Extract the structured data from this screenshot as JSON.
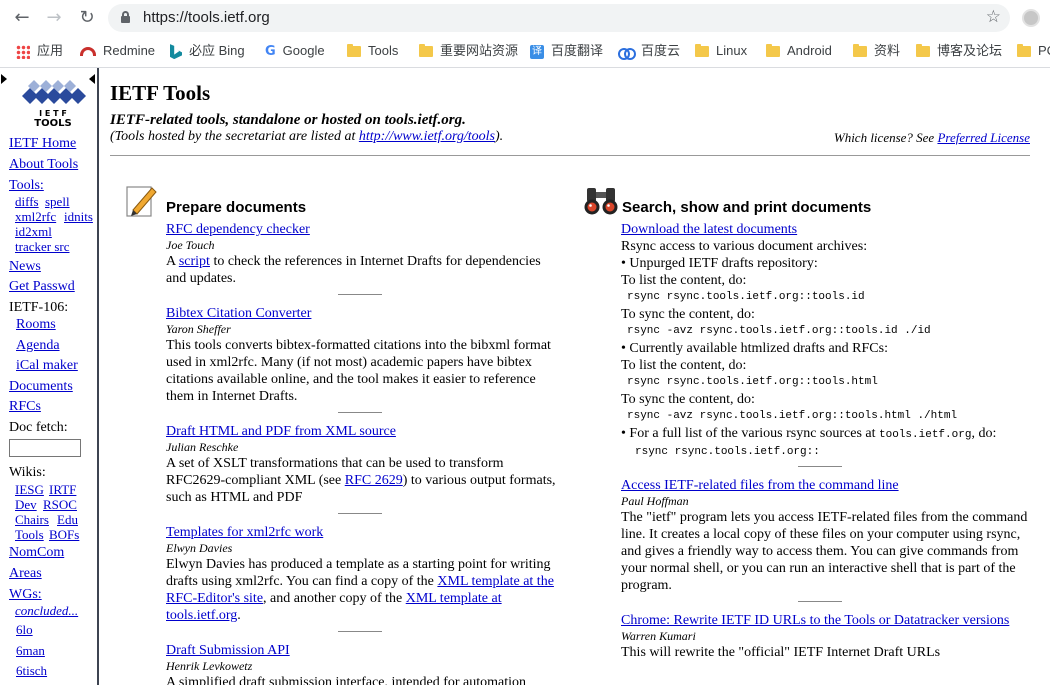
{
  "browser": {
    "url": "https://tools.ietf.org",
    "bookmarks": [
      {
        "label": "应用",
        "icon": "apps-grid-icon"
      },
      {
        "label": "Redmine",
        "icon": "redmine-icon"
      },
      {
        "label": "必应 Bing",
        "icon": "bing-icon"
      },
      {
        "label": "Google",
        "icon": "google-icon"
      },
      {
        "label": "Tools",
        "icon": "folder-icon"
      },
      {
        "label": "重要网站资源",
        "icon": "folder-icon"
      },
      {
        "label": "百度翻译",
        "icon": "translate-icon"
      },
      {
        "label": "百度云",
        "icon": "cloud-icon"
      },
      {
        "label": "Linux",
        "icon": "folder-icon"
      },
      {
        "label": "Android",
        "icon": "folder-icon"
      },
      {
        "label": "资料",
        "icon": "folder-icon"
      },
      {
        "label": "博客及论坛",
        "icon": "folder-icon"
      },
      {
        "label": "PC",
        "icon": "folder-icon"
      }
    ]
  },
  "sidebar": {
    "logo_text": "IETF TOOLS",
    "ietf_home": "IETF Home",
    "about_tools": "About Tools",
    "tools_label": "Tools:",
    "diffs": "diffs",
    "spell": "spell",
    "xml2rfc": "xml2rfc",
    "idnits": "idnits",
    "id2xml": "id2xml",
    "tracker_src": "tracker src",
    "news": "News",
    "get_passwd": "Get Passwd",
    "meeting": "IETF-106:",
    "rooms": "Rooms",
    "agenda": "Agenda",
    "ical": "iCal maker",
    "documents": "Documents",
    "rfcs": "RFCs",
    "doc_fetch": "Doc fetch:",
    "wikis": "Wikis:",
    "iesg": "IESG",
    "irtf": "IRTF",
    "dev": "Dev",
    "rsoc": "RSOC",
    "chairs": "Chairs",
    "edu": "Edu",
    "tools": "Tools",
    "bofs": "BOFs",
    "nomcom": "NomCom",
    "areas": "Areas",
    "wgs": "WGs:",
    "concluded": "concluded...",
    "wg1": "6lo",
    "wg2": "6man",
    "wg3": "6tisch"
  },
  "main": {
    "title": "IETF Tools",
    "subtitle": "IETF-related tools, standalone or hosted on tools.ietf.org.",
    "hosted_prefix": "(Tools hosted by the secretariat are listed at ",
    "hosted_link": "http://www.ietf.org/tools",
    "hosted_suffix": ").",
    "license_prefix": "Which license? See ",
    "license_link": "Preferred License"
  },
  "prepare": {
    "heading": "Prepare documents",
    "e1_title": "RFC dependency checker",
    "e1_author": "Joe Touch",
    "e1_a": "A ",
    "e1_link": "script",
    "e1_b": " to check the references in Internet Drafts for dependencies and updates.",
    "e2_title": "Bibtex Citation Converter",
    "e2_author": "Yaron Sheffer",
    "e2_desc": "This tools converts bibtex-formatted citations into the bibxml format used in xml2rfc. Many (if not most) academic papers have bibtex citations available online, and the tool makes it easier to reference them in Internet Drafts.",
    "e3_title": "Draft HTML and PDF from XML source",
    "e3_author": "Julian Reschke",
    "e3_a": "A set of XSLT transformations that can be used to transform RFC2629-compliant XML (see ",
    "e3_link": "RFC 2629",
    "e3_b": ") to various output formats, such as HTML and PDF",
    "e4_title": "Templates for xml2rfc work",
    "e4_author": "Elwyn Davies",
    "e4_a": "Elwyn Davies has produced a template as a starting point for writing drafts using xml2rfc. You can find a copy of the ",
    "e4_link1": "XML template at the RFC-Editor's site",
    "e4_b": ", and another copy of the ",
    "e4_link2": "XML template at tools.ietf.org",
    "e4_c": ".",
    "e5_title": "Draft Submission API",
    "e5_author": "Henrik Levkowetz",
    "e5_desc": "A simplified draft submission interface, intended for automation"
  },
  "search": {
    "heading": "Search, show and print documents",
    "s1_title": "Download the latest documents",
    "l1": "Rsync access to various document archives:",
    "l2": "• Unpurged IETF drafts repository:",
    "l3": "To list the content, do:",
    "c1": "rsync  rsync.tools.ietf.org::tools.id",
    "l4": "To sync the content, do:",
    "c2": "rsync  -avz  rsync.tools.ietf.org::tools.id  ./id",
    "l5": "• Currently available htmlized drafts and RFCs:",
    "l6": "To list the content, do:",
    "c3": "rsync  rsync.tools.ietf.org::tools.html",
    "l7": "To sync the content, do:",
    "c4": "rsync  -avz  rsync.tools.ietf.org::tools.html  ./html",
    "l8a": "• For a full list of the various rsync sources at ",
    "l8code": "tools.ietf.org",
    "l8b": ", do:",
    "c5": "rsync  rsync.tools.ietf.org::",
    "s2_title": "Access IETF-related files from the command line",
    "s2_author": "Paul Hoffman",
    "s2_desc": "The \"ietf\" program lets you access IETF-related files from the command line. It creates a local copy of these files on your computer using rsync, and gives a friendly way to access them. You can give commands from your normal shell, or you can run an interactive shell that is part of the program.",
    "s3_title": "Chrome: Rewrite IETF ID URLs to the Tools or Datatracker versions",
    "s3_author": "Warren Kumari",
    "s3_desc": "This will rewrite the \"official\" IETF Internet Draft URLs"
  }
}
